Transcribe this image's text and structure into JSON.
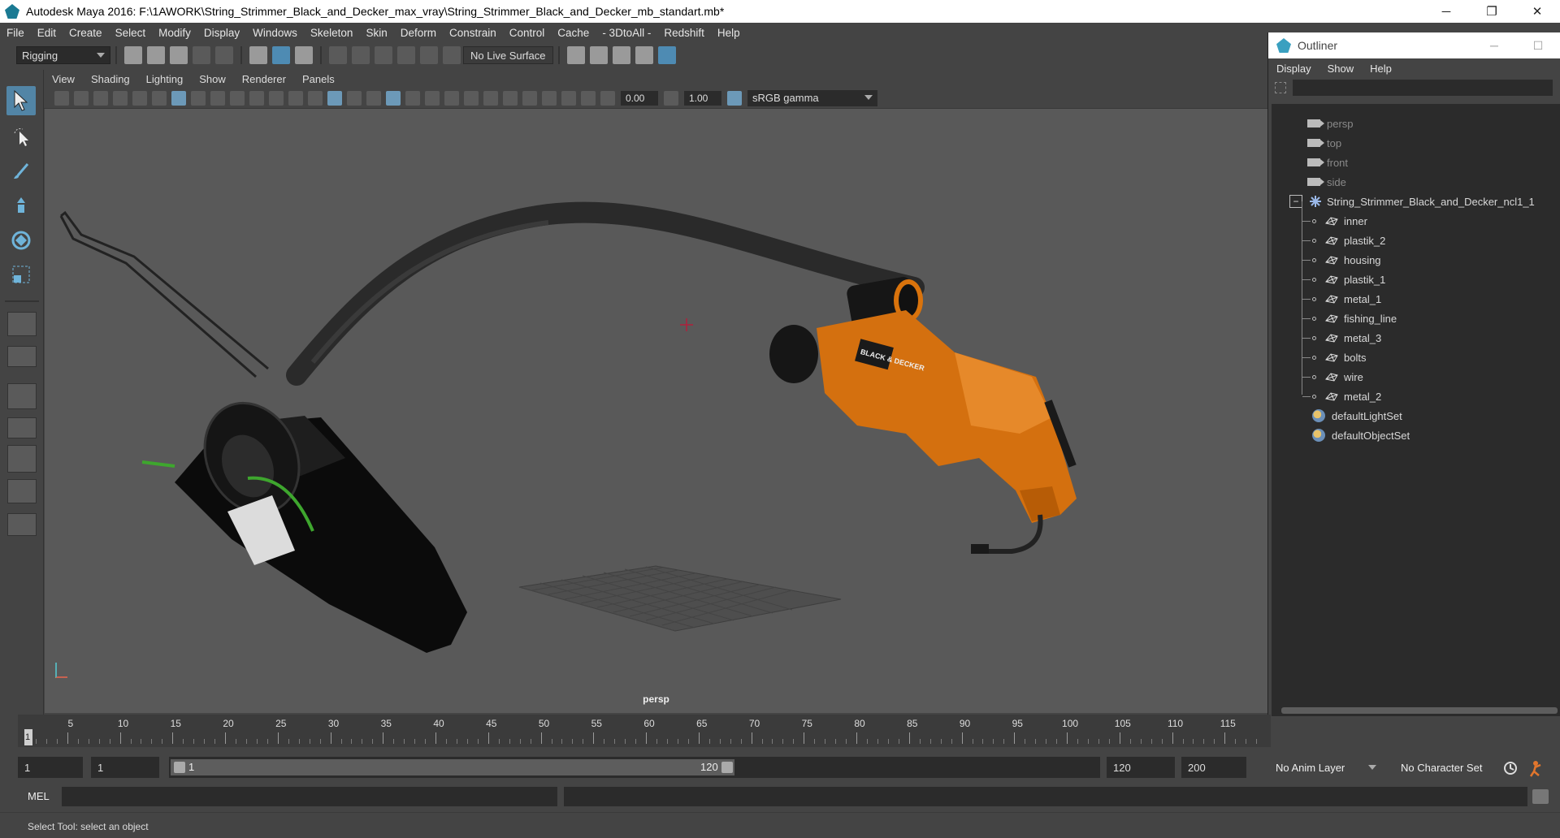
{
  "window": {
    "title": "Autodesk Maya 2016: F:\\1AWORK\\String_Strimmer_Black_and_Decker_max_vray\\String_Strimmer_Black_and_Decker_mb_standart.mb*",
    "minimize": "─",
    "restore": "❐",
    "close": "✕"
  },
  "menubar": [
    "File",
    "Edit",
    "Create",
    "Select",
    "Modify",
    "Display",
    "Windows",
    "Skeleton",
    "Skin",
    "Deform",
    "Constrain",
    "Control",
    "Cache",
    "- 3DtoAll -",
    "Redshift",
    "Help"
  ],
  "statusline": {
    "menuset": "Rigging",
    "live_surface": "No Live Surface"
  },
  "viewport": {
    "menus": [
      "View",
      "Shading",
      "Lighting",
      "Show",
      "Renderer",
      "Panels"
    ],
    "exposure": "0.00",
    "gamma": "1.00",
    "color_space": "sRGB gamma",
    "camera_label": "persp",
    "product_brand": "BLACK & DECKER"
  },
  "outliner": {
    "title": "Outliner",
    "menus": [
      "Display",
      "Show",
      "Help"
    ],
    "cameras": [
      "persp",
      "top",
      "front",
      "side"
    ],
    "group": "String_Strimmer_Black_and_Decker_ncl1_1",
    "expander": "−",
    "children": [
      "inner",
      "plastik_2",
      "housing",
      "plastik_1",
      "metal_1",
      "fishing_line",
      "metal_3",
      "bolts",
      "wire",
      "metal_2"
    ],
    "sets": [
      "defaultLightSet",
      "defaultObjectSet"
    ]
  },
  "timeslider": {
    "labels": [
      "5",
      "10",
      "15",
      "20",
      "25",
      "30",
      "35",
      "40",
      "45",
      "50",
      "55",
      "60",
      "65",
      "70",
      "75",
      "80",
      "85",
      "90",
      "95",
      "100",
      "105",
      "110",
      "115"
    ],
    "current_frame": "1"
  },
  "range": {
    "start_time": "1",
    "playback_start": "1",
    "range_start_label": "1",
    "range_end_label": "120",
    "playback_end": "120",
    "end_time": "200",
    "anim_layer": "No Anim Layer",
    "character_set": "No Character Set"
  },
  "command": {
    "label": "MEL"
  },
  "help_line": "Select Tool: select an object"
}
